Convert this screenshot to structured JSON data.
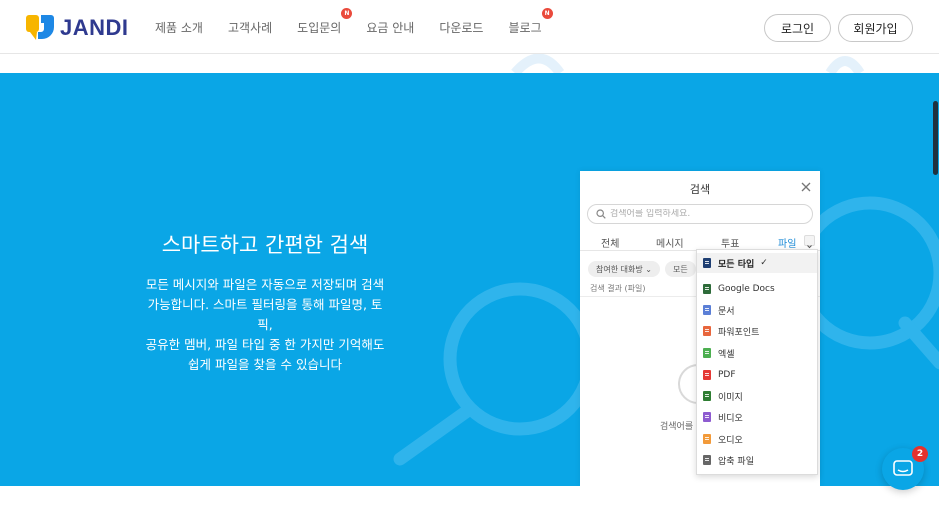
{
  "brand": {
    "name": "JANDI",
    "colors": {
      "yellow": "#f7b500",
      "blue": "#1e88e5",
      "navy": "#2f3a8f",
      "hero": "#0aa6e6"
    }
  },
  "nav": {
    "items": [
      {
        "label": "제품 소개"
      },
      {
        "label": "고객사례"
      },
      {
        "label": "도입문의",
        "badge": "N"
      },
      {
        "label": "요금 안내"
      },
      {
        "label": "다운로드"
      },
      {
        "label": "블로그",
        "badge": "N"
      }
    ]
  },
  "auth": {
    "login_label": "로그인",
    "signup_label": "회원가입"
  },
  "hero": {
    "title": "스마트하고 간편한 검색",
    "description": [
      "모든 메시지와 파일은 자동으로 저장되며 검색",
      "가능합니다. 스마트 필터링을 통해 파일명, 토픽,",
      "공유한 멤버, 파일 타입 중 한 가지만 기억해도",
      "쉽게 파일을 찾을 수 있습니다"
    ]
  },
  "search_panel": {
    "title": "검색",
    "placeholder": "검색어를 입력하세요.",
    "tabs": [
      {
        "label": "전체"
      },
      {
        "label": "메시지"
      },
      {
        "label": "투표"
      },
      {
        "label": "파일",
        "active": true
      }
    ],
    "chips": [
      "참여한 대화방 ⌄",
      "모든"
    ],
    "result_label": "검색 결과 (파일)",
    "empty_text": "검색어를"
  },
  "file_type_dropdown": {
    "items": [
      {
        "label": "모든 타입",
        "icon": "all-files-icon",
        "color": "#1f3f73",
        "selected": true
      },
      {
        "label": "Google Docs",
        "icon": "google-docs-icon",
        "color": "#2e6b3a"
      },
      {
        "label": "문서",
        "icon": "document-icon",
        "color": "#5b7fd6"
      },
      {
        "label": "파워포인트",
        "icon": "powerpoint-icon",
        "color": "#e8663d"
      },
      {
        "label": "엑셀",
        "icon": "excel-icon",
        "color": "#4caf50"
      },
      {
        "label": "PDF",
        "icon": "pdf-icon",
        "color": "#e53935"
      },
      {
        "label": "이미지",
        "icon": "image-icon",
        "color": "#2e7d32"
      },
      {
        "label": "비디오",
        "icon": "video-icon",
        "color": "#8e5bd0"
      },
      {
        "label": "오디오",
        "icon": "audio-icon",
        "color": "#f29a3a"
      },
      {
        "label": "압축 파일",
        "icon": "archive-icon",
        "color": "#666666"
      }
    ],
    "check_mark": "✓"
  },
  "chat": {
    "unread_count": "2"
  }
}
